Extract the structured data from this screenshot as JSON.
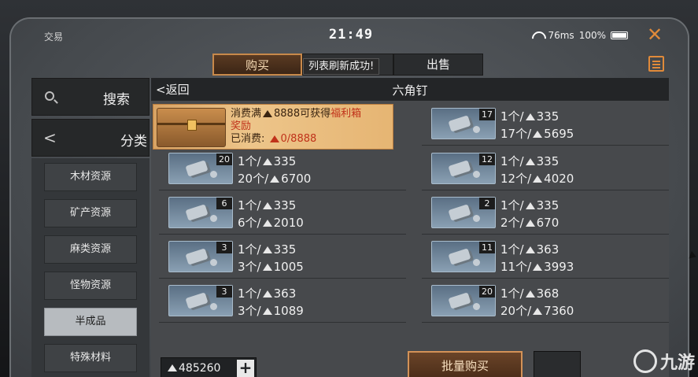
{
  "status": {
    "left_label": "交易",
    "time": "21:49",
    "ping": "76ms",
    "battery": "100%"
  },
  "tabs": [
    {
      "label": "购买",
      "active": true
    },
    {
      "label": "",
      "active": false
    },
    {
      "label": "出售",
      "active": false
    }
  ],
  "toast": "列表刷新成功!",
  "sidebar": {
    "search_label": "搜索",
    "category_label": "分类",
    "items": [
      {
        "label": "木材资源",
        "active": false
      },
      {
        "label": "矿产资源",
        "active": false
      },
      {
        "label": "麻类资源",
        "active": false
      },
      {
        "label": "怪物资源",
        "active": false
      },
      {
        "label": "半成品",
        "active": true
      },
      {
        "label": "特殊材料",
        "active": false
      }
    ]
  },
  "header": {
    "back_label": "返回",
    "title": "六角钉"
  },
  "promo": {
    "line1_prefix": "消费满",
    "line1_amount": "8888可获得",
    "line1_reward": "福利箱",
    "line2": "奖励",
    "consumed_label": "已消费:",
    "consumed_value": "0/8888"
  },
  "listings": [
    {
      "qty": "17",
      "unit_prefix": "1个/",
      "unit_price": "335",
      "total_prefix": "17个/",
      "total_price": "5695"
    },
    {
      "qty": "20",
      "unit_prefix": "1个/",
      "unit_price": "335",
      "total_prefix": "20个/",
      "total_price": "6700"
    },
    {
      "qty": "12",
      "unit_prefix": "1个/",
      "unit_price": "335",
      "total_prefix": "12个/",
      "total_price": "4020"
    },
    {
      "qty": "6",
      "unit_prefix": "1个/",
      "unit_price": "335",
      "total_prefix": "6个/",
      "total_price": "2010"
    },
    {
      "qty": "2",
      "unit_prefix": "1个/",
      "unit_price": "335",
      "total_prefix": "2个/",
      "total_price": "670"
    },
    {
      "qty": "3",
      "unit_prefix": "1个/",
      "unit_price": "335",
      "total_prefix": "3个/",
      "total_price": "1005"
    },
    {
      "qty": "11",
      "unit_prefix": "1个/",
      "unit_price": "363",
      "total_prefix": "11个/",
      "total_price": "3993"
    },
    {
      "qty": "3",
      "unit_prefix": "1个/",
      "unit_price": "363",
      "total_prefix": "3个/",
      "total_price": "1089"
    },
    {
      "qty": "20",
      "unit_prefix": "1个/",
      "unit_price": "368",
      "total_prefix": "20个/",
      "total_price": "7360"
    }
  ],
  "footer": {
    "wallet_amount": "485260",
    "plus_label": "+",
    "bulk_buy_label": "批量购买"
  },
  "watermark": "九游",
  "colors": {
    "accent": "#d39257",
    "promo_highlight": "#c0321a"
  }
}
